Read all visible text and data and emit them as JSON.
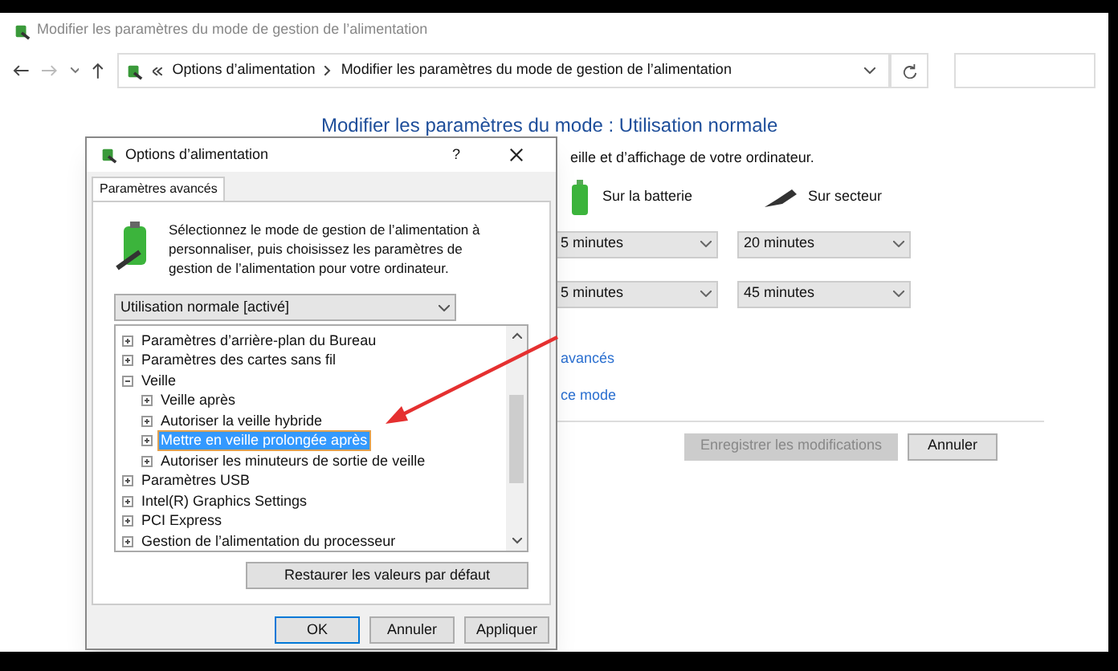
{
  "window": {
    "title": "Modifier les paramètres du mode de gestion de l’alimentation"
  },
  "address_bar": {
    "breadcrumbs": [
      "Options d’alimentation",
      "Modifier les paramètres du mode de gestion de l’alimentation"
    ]
  },
  "main": {
    "heading": "Modifier les paramètres du mode : Utilisation normale",
    "description": "eille et d’affichage de votre ordinateur.",
    "columns": [
      "Sur la batterie",
      "Sur secteur"
    ],
    "rows": [
      {
        "battery": "5 minutes",
        "plugged": "20 minutes"
      },
      {
        "battery": "5 minutes",
        "plugged": "45 minutes"
      }
    ],
    "links": [
      "avancés",
      "ce mode"
    ],
    "buttons": [
      {
        "label": "Enregistrer les modifications",
        "disabled": true
      },
      {
        "label": "Annuler",
        "disabled": false
      }
    ]
  },
  "dialog": {
    "title": "Options d’alimentation",
    "help": "?",
    "tab": {
      "label": "Paramètres avancés",
      "selected": true
    },
    "intro": "Sélectionnez le mode de gestion de l’alimentation à personnaliser, puis choisissez les paramètres de gestion de l’alimentation pour votre ordinateur.",
    "plan": "Utilisation normale [activé]",
    "tree": [
      {
        "label": "Paramètres d’arrière-plan du Bureau",
        "expanded": false,
        "selected": false
      },
      {
        "label": "Paramètres des cartes sans fil",
        "expanded": false,
        "selected": false
      },
      {
        "label": "Veille",
        "expanded": true,
        "selected": false,
        "children": [
          {
            "label": "Veille après",
            "expanded": false,
            "selected": false
          },
          {
            "label": "Autoriser la veille hybride",
            "expanded": false,
            "selected": false
          },
          {
            "label": "Mettre en veille prolongée après",
            "expanded": false,
            "selected": true
          },
          {
            "label": "Autoriser les minuteurs de sortie de veille",
            "expanded": false,
            "selected": false
          }
        ]
      },
      {
        "label": "Paramètres USB",
        "expanded": false,
        "selected": false
      },
      {
        "label": "Intel(R) Graphics Settings",
        "expanded": false,
        "selected": false
      },
      {
        "label": "PCI Express",
        "expanded": false,
        "selected": false
      },
      {
        "label": "Gestion de l’alimentation du processeur",
        "expanded": false,
        "selected": false
      }
    ],
    "restore_button": "Restaurer les valeurs par défaut",
    "buttons": [
      "OK",
      "Annuler",
      "Appliquer"
    ]
  }
}
